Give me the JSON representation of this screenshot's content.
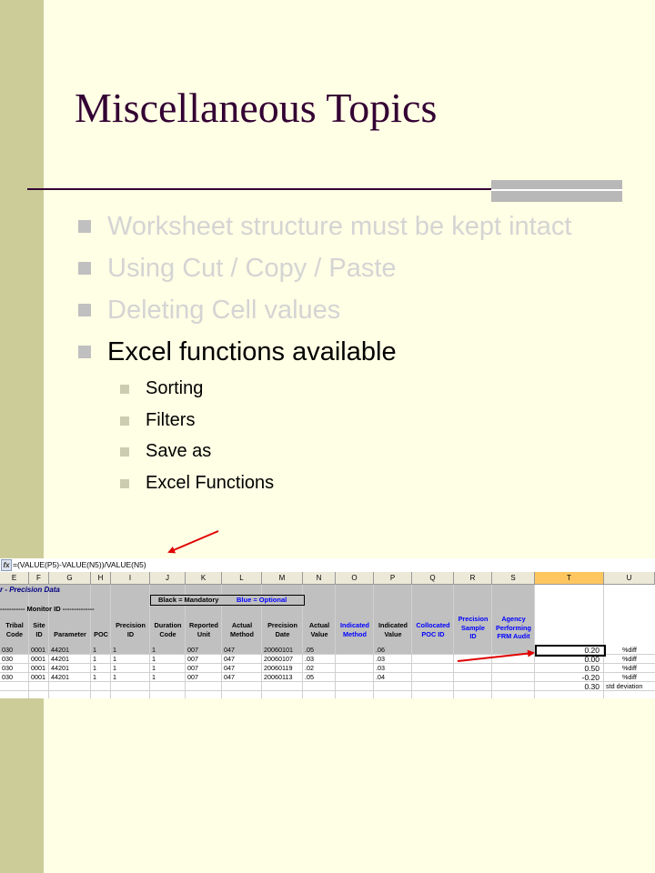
{
  "slide": {
    "title": "Miscellaneous Topics",
    "bullets": [
      {
        "text": "Worksheet structure must be kept intact",
        "state": "dimmed"
      },
      {
        "text": "Using Cut / Copy / Paste",
        "state": "dimmed"
      },
      {
        "text": "Deleting Cell values",
        "state": "dimmed"
      },
      {
        "text": "Excel functions available",
        "state": "active"
      }
    ],
    "sub_bullets": [
      "Sorting",
      "Filters",
      "Save as",
      "Excel Functions"
    ],
    "colors": {
      "background": "#FFFFE5",
      "sidebar": "#CCCC99",
      "title": "#330033",
      "dimmed": "#D4D4D4"
    }
  },
  "spreadsheet": {
    "fx_icon": "fx-icon",
    "formula": "=(VALUE(P5)-VALUE(N5))/VALUE(N5)",
    "columns": [
      "E",
      "F",
      "G",
      "H",
      "I",
      "J",
      "K",
      "L",
      "M",
      "N",
      "O",
      "P",
      "Q",
      "R",
      "S",
      "T",
      "U"
    ],
    "selected_column": "T",
    "sheet_title": "r - Precision Data",
    "legend_black": "Black = Mandatory",
    "legend_blue": "Blue = Optional",
    "monitor_label": "----------- Monitor ID --------------",
    "headers": [
      {
        "text": "Tribal Code",
        "color": "black"
      },
      {
        "text": "Site ID",
        "color": "black"
      },
      {
        "text": "Parameter",
        "color": "black"
      },
      {
        "text": "POC",
        "color": "black"
      },
      {
        "text": "Precision ID",
        "color": "black"
      },
      {
        "text": "Duration Code",
        "color": "black"
      },
      {
        "text": "Reported Unit",
        "color": "black"
      },
      {
        "text": "Actual Method",
        "color": "black"
      },
      {
        "text": "Precision Date",
        "color": "black"
      },
      {
        "text": "Actual Value",
        "color": "black"
      },
      {
        "text": "Indicated Method",
        "color": "blue"
      },
      {
        "text": "Indicated Value",
        "color": "black"
      },
      {
        "text": "Collocated POC ID",
        "color": "blue"
      },
      {
        "text": "Precision Sample ID",
        "color": "blue"
      },
      {
        "text": "Agency Performing FRM Audit",
        "color": "blue"
      }
    ],
    "rows": [
      {
        "tribal": "030",
        "site": "0001",
        "param": "44201",
        "poc": "1",
        "prec_id": "1",
        "duration": "1",
        "unit": "007",
        "method": "047",
        "date": "20060101",
        "actual": ".05",
        "indicated": ".06",
        "t": "0.20",
        "u": "%diff"
      },
      {
        "tribal": "030",
        "site": "0001",
        "param": "44201",
        "poc": "1",
        "prec_id": "1",
        "duration": "1",
        "unit": "007",
        "method": "047",
        "date": "20060107",
        "actual": ".03",
        "indicated": ".03",
        "t": "0.00",
        "u": "%diff"
      },
      {
        "tribal": "030",
        "site": "0001",
        "param": "44201",
        "poc": "1",
        "prec_id": "1",
        "duration": "1",
        "unit": "007",
        "method": "047",
        "date": "20060119",
        "actual": ".02",
        "indicated": ".03",
        "t": "0.50",
        "u": "%diff"
      },
      {
        "tribal": "030",
        "site": "0001",
        "param": "44201",
        "poc": "1",
        "prec_id": "1",
        "duration": "1",
        "unit": "007",
        "method": "047",
        "date": "20060113",
        "actual": ".05",
        "indicated": ".04",
        "t": "-0.20",
        "u": "%diff"
      }
    ],
    "summary": {
      "t": "0.30",
      "u": "std deviation"
    }
  }
}
